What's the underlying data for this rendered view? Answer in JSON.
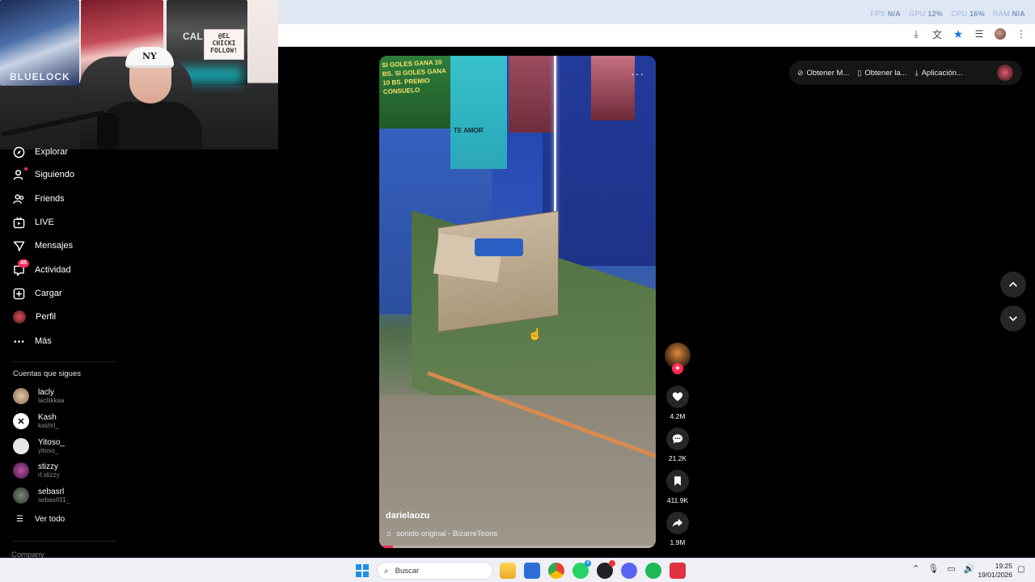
{
  "browser": {
    "hud": {
      "fps_label": "FPS",
      "fps_value": "N/A",
      "gpu_label": "GPU",
      "gpu_value": "12%",
      "cpu_label": "CPU",
      "cpu_value": "16%",
      "ram_label": "RAM",
      "ram_value": "N/A"
    }
  },
  "webcam": {
    "sticker_text": "@EL CHICKI FOLLOW!",
    "poster_text": "BLUELOCK",
    "poster_text2": "CAL",
    "cap_logo": "NY"
  },
  "sidebar": {
    "nav": [
      {
        "label": "Explorar",
        "icon": "compass-icon"
      },
      {
        "label": "Siguiendo",
        "icon": "following-icon"
      },
      {
        "label": "Friends",
        "icon": "friends-icon"
      },
      {
        "label": "LIVE",
        "icon": "live-icon"
      },
      {
        "label": "Mensajes",
        "icon": "messages-icon"
      },
      {
        "label": "Actividad",
        "icon": "activity-icon",
        "badge": "45"
      },
      {
        "label": "Cargar",
        "icon": "upload-icon"
      },
      {
        "label": "Perfil",
        "icon": "profile-avatar"
      },
      {
        "label": "Más",
        "icon": "more-icon"
      }
    ],
    "section_title": "Cuentas que sigues",
    "following": [
      {
        "name": "lacly",
        "handle": "lacliikkaa"
      },
      {
        "name": "Kash",
        "handle": "kashrl_"
      },
      {
        "name": "Yitoso_",
        "handle": "yitoso_"
      },
      {
        "name": "stizzy",
        "handle": "rl.stizzy"
      },
      {
        "name": "sebasrl",
        "handle": "sebasrl31_"
      }
    ],
    "see_all": "Ver todo",
    "company": "Company"
  },
  "video": {
    "author": "darielaozu",
    "music": "sonido original - BizarreToons",
    "banner_text": "SI GOLES GANA 10 BS. SI GOLES GANA 10 BS. PREMIO CONSUELO",
    "towel_text": "TE AMOR",
    "progress": 0.05
  },
  "actions": {
    "likes": "4.2M",
    "comments": "21.2K",
    "saves": "411.9K",
    "shares": "1.9M"
  },
  "top_actions": {
    "get_m": "Obtener M...",
    "get_la": "Obtener la...",
    "app": "Aplicación..."
  },
  "taskbar": {
    "search_placeholder": "Buscar",
    "time": "19:25",
    "date": "19/01/2026",
    "whatsapp_badge": "4"
  },
  "colors": {
    "accent": "#fe2c55",
    "browser_star": "#1a73e8",
    "windows_blue": "#1f8fe8"
  }
}
